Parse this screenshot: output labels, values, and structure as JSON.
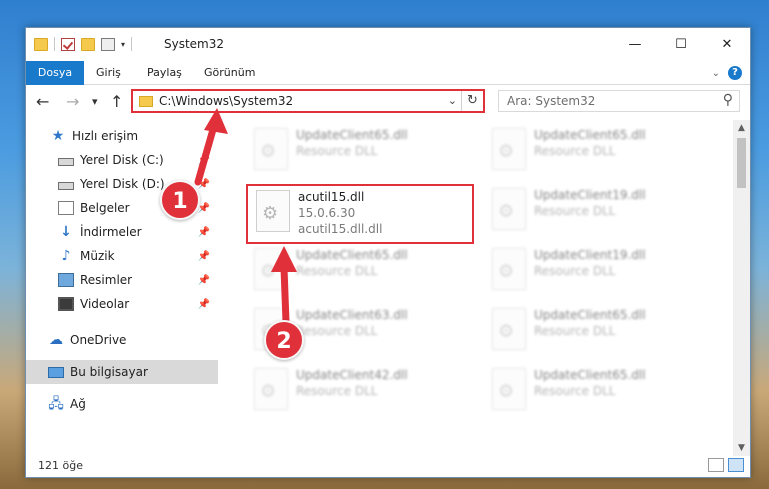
{
  "title_bar": {
    "window_title": "System32",
    "buttons": {
      "minimize": "—",
      "maximize": "☐",
      "close": "✕"
    }
  },
  "ribbon": {
    "tabs": [
      {
        "label": "Dosya",
        "active": true
      },
      {
        "label": "Giriş",
        "active": false
      },
      {
        "label": "Paylaş",
        "active": false
      },
      {
        "label": "Görünüm",
        "active": false
      }
    ],
    "help_label": "?"
  },
  "navigation": {
    "back": "←",
    "forward": "→",
    "recent": "▾",
    "up": "↑",
    "address_path": "C:\\Windows\\System32",
    "address_dropdown": "⌄",
    "refresh": "↻",
    "search_placeholder": "Ara: System32",
    "search_icon": "⚲"
  },
  "sidebar": {
    "items": [
      {
        "label": "Hızlı erişim",
        "icon": "star-icon",
        "pinned": false
      },
      {
        "label": "Yerel Disk (C:)",
        "icon": "drive-icon",
        "pinned": true
      },
      {
        "label": "Yerel Disk (D:)",
        "icon": "drive-icon",
        "pinned": true
      },
      {
        "label": "Belgeler",
        "icon": "documents-icon",
        "pinned": true
      },
      {
        "label": "İndirmeler",
        "icon": "download-icon",
        "pinned": true
      },
      {
        "label": "Müzik",
        "icon": "music-icon",
        "pinned": true
      },
      {
        "label": "Resimler",
        "icon": "pictures-icon",
        "pinned": true
      },
      {
        "label": "Videolar",
        "icon": "videos-icon",
        "pinned": true
      },
      {
        "label": "OneDrive",
        "icon": "cloud-icon",
        "pinned": false
      },
      {
        "label": "Bu bilgisayar",
        "icon": "computer-icon",
        "pinned": false,
        "selected": true
      },
      {
        "label": "Ağ",
        "icon": "network-icon",
        "pinned": false
      }
    ]
  },
  "files": {
    "featured": {
      "name": "acutil15.dll",
      "version": "15.0.6.30",
      "subname": "acutil15.dll.dll"
    },
    "background": [
      {
        "name": "UpdateClient65.dll",
        "desc": "Resource DLL"
      },
      {
        "name": "UpdateClient65.dll",
        "desc": "Resource DLL"
      },
      {
        "name": "UpdateClient19.dll",
        "desc": "Resource DLL"
      },
      {
        "name": "UpdateClient65.dll",
        "desc": "Resource DLL"
      },
      {
        "name": "UpdateClient19.dll",
        "desc": "Resource DLL"
      },
      {
        "name": "UpdateClient63.dll",
        "desc": "Resource DLL"
      },
      {
        "name": "UpdateClient65.dll",
        "desc": "Resource DLL"
      },
      {
        "name": "UpdateClient42.dll",
        "desc": "Resource DLL"
      },
      {
        "name": "UpdateClient65.dll",
        "desc": "Resource DLL"
      }
    ]
  },
  "status_bar": {
    "item_count": "121 öğe"
  },
  "annotations": {
    "callout_1": "1",
    "callout_2": "2",
    "color": "#e0303a"
  }
}
